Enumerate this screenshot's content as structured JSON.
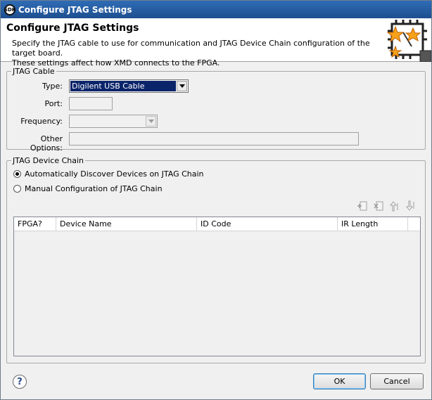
{
  "window": {
    "title": "Configure JTAG Settings",
    "app_icon": "SDK"
  },
  "banner": {
    "title": "Configure JTAG Settings",
    "line1": "Specify the JTAG cable to use for communication and JTAG Device Chain configuration of the target board.",
    "line2": "These settings affect how XMD connects to the FPGA."
  },
  "cable": {
    "group": "JTAG Cable",
    "type_label": "Type:",
    "type_value": "Digilent USB Cable",
    "port_label": "Port:",
    "port_value": "",
    "frequency_label": "Frequency:",
    "frequency_value": "",
    "other_label": "Other Options:",
    "other_value": ""
  },
  "chain": {
    "group": "JTAG Device Chain",
    "auto_label": "Automatically Discover Devices on JTAG Chain",
    "manual_label": "Manual Configuration of JTAG Chain",
    "selected": "auto",
    "columns": [
      "FPGA?",
      "Device Name",
      "ID Code",
      "IR Length"
    ]
  },
  "buttons": {
    "ok": "OK",
    "cancel": "Cancel"
  },
  "colors": {
    "title_bar": "#2f6cb6",
    "selection": "#0a246a"
  }
}
